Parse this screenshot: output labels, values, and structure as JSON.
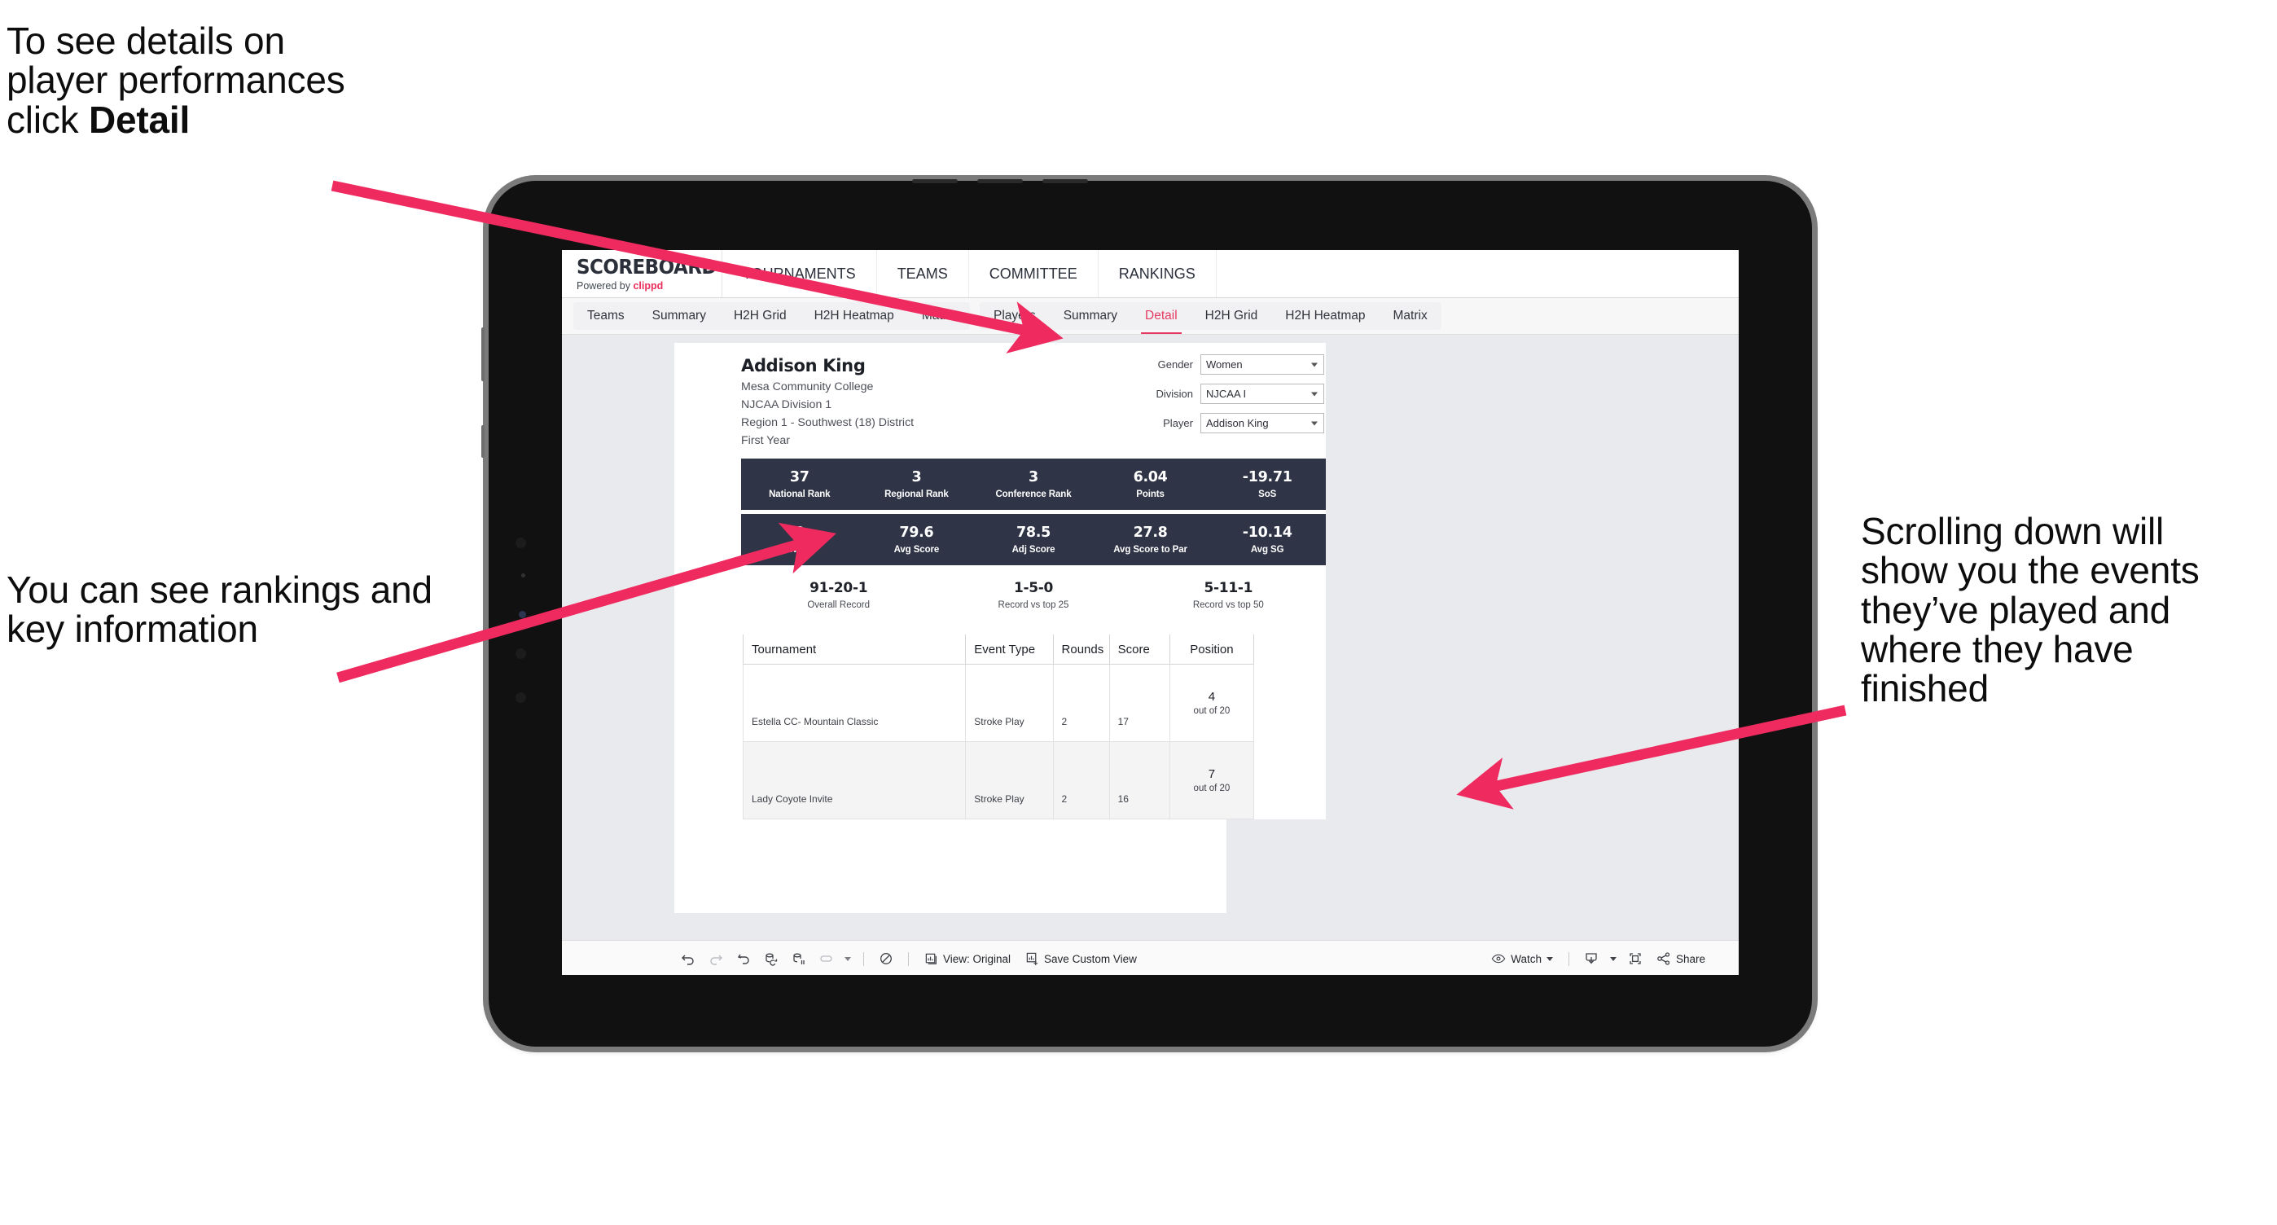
{
  "annotations": {
    "detail_note_line1": "To see details on",
    "detail_note_line2": "player performances",
    "detail_note_line3_pre": "click ",
    "detail_note_line3_bold": "Detail",
    "rankings_note": "You can see rankings and key information",
    "scroll_note": "Scrolling down will show you the events they’ve played and where they have finished"
  },
  "app": {
    "logo_word": "SCOREBOARD",
    "logo_powered_pre": "Powered by ",
    "logo_brand": "clippd",
    "top_nav": [
      "TOURNAMENTS",
      "TEAMS",
      "COMMITTEE",
      "RANKINGS"
    ],
    "team_tabs": [
      "Teams",
      "Summary",
      "H2H Grid",
      "H2H Heatmap",
      "Matrix"
    ],
    "player_tabs": [
      "Players",
      "Summary",
      "Detail",
      "H2H Grid",
      "H2H Heatmap",
      "Matrix"
    ],
    "active_player_tab": "Detail",
    "accent_color": "#e53a62",
    "band_color": "#2f3446"
  },
  "player": {
    "name": "Addison King",
    "school": "Mesa Community College",
    "division": "NJCAA Division 1",
    "region": "Region 1 - Southwest (18) District",
    "year": "First Year"
  },
  "filters": [
    {
      "label": "Gender",
      "value": "Women"
    },
    {
      "label": "Division",
      "value": "NJCAA I"
    },
    {
      "label": "Player",
      "value": "Addison King"
    }
  ],
  "stats_row_1": [
    {
      "value": "37",
      "label": "National Rank"
    },
    {
      "value": "3",
      "label": "Regional Rank"
    },
    {
      "value": "3",
      "label": "Conference Rank"
    },
    {
      "value": "6.04",
      "label": "Points"
    },
    {
      "value": "-19.71",
      "label": "SoS"
    }
  ],
  "stats_row_2": [
    {
      "value": "0",
      "label": "Wins"
    },
    {
      "value": "79.6",
      "label": "Avg Score"
    },
    {
      "value": "78.5",
      "label": "Adj Score"
    },
    {
      "value": "27.8",
      "label": "Avg Score to Par"
    },
    {
      "value": "-10.14",
      "label": "Avg SG"
    }
  ],
  "records": [
    {
      "value": "91-20-1",
      "label": "Overall Record"
    },
    {
      "value": "1-5-0",
      "label": "Record vs top 25"
    },
    {
      "value": "5-11-1",
      "label": "Record vs top 50"
    }
  ],
  "events_table": {
    "columns": [
      "Tournament",
      "Event Type",
      "Rounds",
      "Score",
      "Position"
    ],
    "rows": [
      {
        "tournament": "Estella CC- Mountain Classic",
        "event_type": "Stroke Play",
        "rounds": "2",
        "score": "17",
        "position": "4",
        "position_out_of": "out of 20"
      },
      {
        "tournament": "Lady Coyote Invite",
        "event_type": "Stroke Play",
        "rounds": "2",
        "score": "16",
        "position": "7",
        "position_out_of": "out of 20"
      }
    ]
  },
  "toolbar": {
    "view_label": "View: Original",
    "save_label": "Save Custom View",
    "watch_label": "Watch",
    "share_label": "Share"
  }
}
